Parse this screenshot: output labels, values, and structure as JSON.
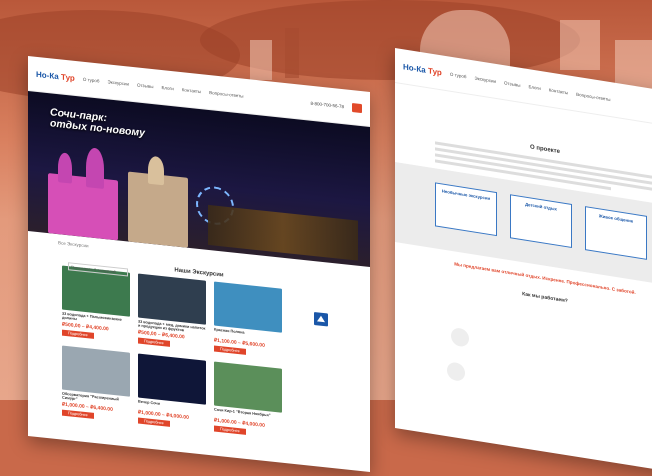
{
  "brand": {
    "logo_main": "Но-Ка",
    "logo_accent": "Тур"
  },
  "nav": [
    "О туроб",
    "Экскурсии",
    "Отзывы",
    "Блоги",
    "Контакты",
    "Вопросы-ответы"
  ],
  "phone": "8-800-700-56-78",
  "hero": {
    "title_line1": "Сочи-парк:",
    "title_line2": "отдых по-новому"
  },
  "breadcrumb": "Все Экскурсии",
  "sort_label": "Показывать 9 экскурсий",
  "section_title": "Наши Экскурсии",
  "tours": [
    {
      "name": "33 водопада + Пальмовинзекие долины",
      "price": "₽500,00 – ₽4,400.00",
      "color": "#3d7a4e"
    },
    {
      "name": "33 водопада + мед, домики напиток и продукции из фруктов",
      "price": "₽500,00 – ₽6,400.00",
      "color": "#2f3e4f"
    },
    {
      "name": "Красная Поляна",
      "price": "₽1,100.00 – ₽5,600.00",
      "color": "#3f8fbf"
    },
    {
      "name": "Обсерватория \"Расширениый Симург\"",
      "price": "₽1,000.00 – ₽6,400.00",
      "color": "#9aa7b1"
    },
    {
      "name": "Вечер Сочи",
      "price": "₽1,000.00 – ₽4,000.00",
      "color": "#0f1638"
    },
    {
      "name": "Сочи Кир-1 \"Вторая Ноябрья\"",
      "price": "₽1,000.00 – ₽4,000.00",
      "color": "#5b8f5a"
    }
  ],
  "more_label": "Подробнее",
  "right": {
    "about_title": "О проекте",
    "boxes": [
      "Необычные экскурсии",
      "Детский отдых",
      "Живое общение"
    ],
    "slogan": "Мы предлагаем вам отличный отдых. Искренне. Профессионально. С заботой.",
    "how_title": "Как мы работаем?"
  },
  "colors": {
    "accent": "#e0452a",
    "brand_blue": "#1a57a8"
  }
}
